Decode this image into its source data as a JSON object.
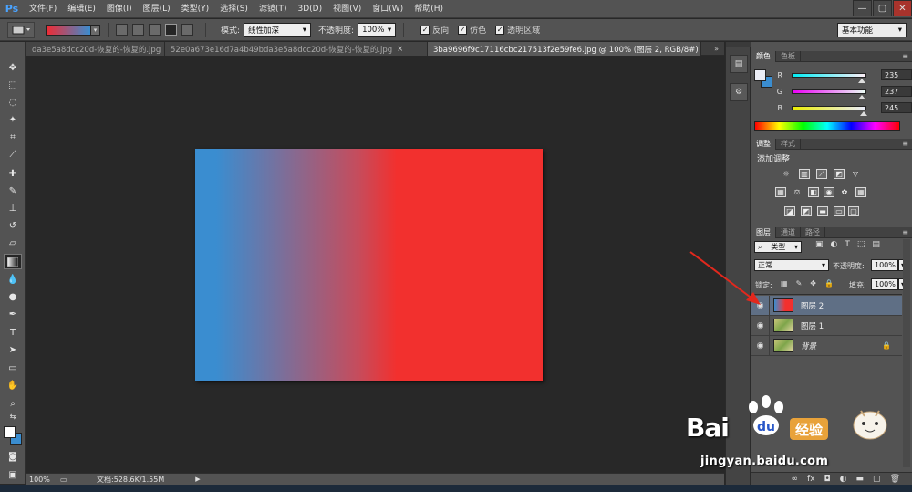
{
  "menubar": {
    "logo": "Ps",
    "items": [
      "文件(F)",
      "编辑(E)",
      "图像(I)",
      "图层(L)",
      "类型(Y)",
      "选择(S)",
      "滤镜(T)",
      "3D(D)",
      "视图(V)",
      "窗口(W)",
      "帮助(H)"
    ],
    "window_controls": [
      "—",
      "▢",
      "✕"
    ]
  },
  "options": {
    "mode_label": "模式:",
    "mode_value": "线性加深",
    "opacity_label": "不透明度:",
    "opacity_value": "100%",
    "reverse_label": "反向",
    "dither_label": "仿色",
    "transparency_label": "透明区域",
    "workspace": "基本功能",
    "gradient_colors": [
      "#f02b33",
      "#3a8dd0"
    ]
  },
  "tabs": [
    {
      "label": "da3e5a8dcc20d-恢复的-恢复的.jpg",
      "active": false
    },
    {
      "label": "52e0a673e16d7a4b49bda3e5a8dcc20d-恢复的-恢复的.jpg",
      "active": false
    },
    {
      "label": "3ba9696f9c17116cbc217513f2e59fe6.jpg @ 100% (图层 2, RGB/8#) *",
      "active": true
    }
  ],
  "status": {
    "zoom": "100%",
    "doc_size": "文档:528.6K/1.55M"
  },
  "color_panel": {
    "tabs": [
      "颜色",
      "色板"
    ],
    "r_label": "R",
    "r_value": "235",
    "g_label": "G",
    "g_value": "237",
    "b_label": "B",
    "b_value": "245"
  },
  "adjust_panel": {
    "tabs": [
      "调整",
      "样式"
    ],
    "title": "添加调整"
  },
  "layers_panel": {
    "tabs": [
      "图层",
      "通道",
      "路径"
    ],
    "filter_label": "类型",
    "blend_mode": "正常",
    "opacity_label": "不透明度:",
    "opacity_value": "100%",
    "lock_label": "锁定:",
    "fill_label": "填充:",
    "fill_value": "100%",
    "layers": [
      {
        "name": "图层 2",
        "selected": true
      },
      {
        "name": "图层 1",
        "selected": false
      },
      {
        "name": "背景",
        "selected": false
      }
    ]
  },
  "watermark": {
    "brand": "Bai",
    "badge": "经验",
    "url": "jingyan.baidu.com"
  },
  "colors": {
    "foreground": "#ffffff",
    "background": "#3a8dd0",
    "canvas_left": "#3a8dd0",
    "canvas_right": "#f2302e",
    "arrow": "#e2281d"
  }
}
